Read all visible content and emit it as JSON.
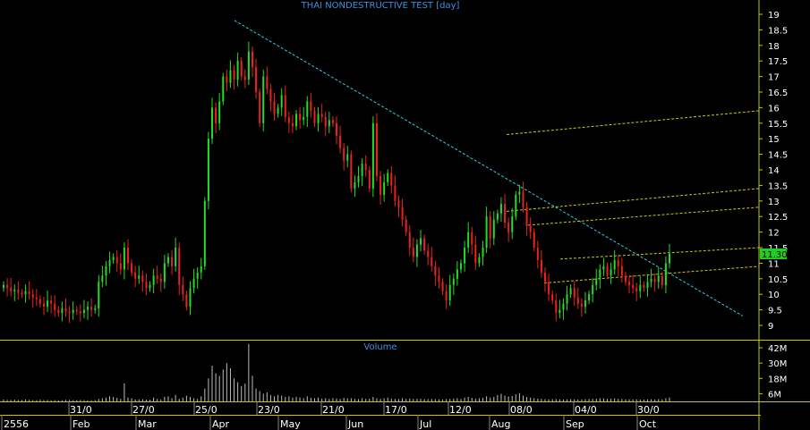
{
  "chart_data": {
    "type": "candlestick",
    "title": "THAI NONDESTRUCTIVE TEST [day]",
    "volume_title": "Volume",
    "price_axis": {
      "min": 9,
      "max": 19,
      "ticks": [
        19,
        18.5,
        18,
        17.5,
        17,
        16.5,
        16,
        15.5,
        15,
        14.5,
        14,
        13.5,
        13,
        12.5,
        12,
        11.5,
        11,
        10.5,
        10,
        9.5,
        9
      ]
    },
    "volume_axis": {
      "ticks": [
        "42M",
        "30M",
        "18M",
        "6M"
      ],
      "max_m": 48
    },
    "last_price": "11.30",
    "date_ticks": [
      "31/0",
      "27/0",
      "25/0",
      "23/0",
      "21/0",
      "17/0",
      "12/0",
      "08/0",
      "04/0",
      "30/0"
    ],
    "month_labels": [
      "2556",
      "Feb",
      "Mar",
      "Apr",
      "May",
      "Jun",
      "Jul",
      "Aug",
      "Sep",
      "Oct"
    ],
    "colors": {
      "up": "#22dd22",
      "down": "#ee2020",
      "trend": "#2fd0e0",
      "channel": "#c8c820",
      "axis": "#c8c800",
      "last_label": "#22cc22",
      "title": "#3d8fe0"
    },
    "closes": [
      10.3,
      10.2,
      10.1,
      10.15,
      10.05,
      10.0,
      10.1,
      10.0,
      9.9,
      9.85,
      9.7,
      9.6,
      9.8,
      9.7,
      9.5,
      9.4,
      9.55,
      9.45,
      9.4,
      9.5,
      9.45,
      9.4,
      9.5,
      9.6,
      9.5,
      9.55,
      10.4,
      10.6,
      10.9,
      11.1,
      11.2,
      11.0,
      10.8,
      11.5,
      11.0,
      10.7,
      10.5,
      10.6,
      10.4,
      10.2,
      10.3,
      10.6,
      10.5,
      10.4,
      11.0,
      11.2,
      10.9,
      11.5,
      10.3,
      10.0,
      9.6,
      10.2,
      10.5,
      10.7,
      10.9,
      13.0,
      15.0,
      16.0,
      15.5,
      16.2,
      17.0,
      16.8,
      17.2,
      16.9,
      17.5,
      17.0,
      16.9,
      17.8,
      17.3,
      16.5,
      15.5,
      17.0,
      16.6,
      16.2,
      15.8,
      16.0,
      16.4,
      15.7,
      15.5,
      15.4,
      15.8,
      15.6,
      15.7,
      16.2,
      15.9,
      15.5,
      15.8,
      15.7,
      15.4,
      15.6,
      15.5,
      15.1,
      14.7,
      14.3,
      14.5,
      13.4,
      13.6,
      13.8,
      14.2,
      14.0,
      13.4,
      15.5,
      13.8,
      13.2,
      13.6,
      13.9,
      13.5,
      13.0,
      12.8,
      12.4,
      12.0,
      11.5,
      11.2,
      11.6,
      11.8,
      11.4,
      11.2,
      10.9,
      10.6,
      10.4,
      10.1,
      9.8,
      10.3,
      10.5,
      10.8,
      11.0,
      11.5,
      12.0,
      11.6,
      11.0,
      11.2,
      11.5,
      12.5,
      11.8,
      12.4,
      12.6,
      12.9,
      12.3,
      12.0,
      12.5,
      13.2,
      13.3,
      12.8,
      12.2,
      12.0,
      11.5,
      11.1,
      10.7,
      10.4,
      10.0,
      9.8,
      9.4,
      9.5,
      9.7,
      10.0,
      10.2,
      9.9,
      9.7,
      9.6,
      9.8,
      10.0,
      10.3,
      10.5,
      10.8,
      10.9,
      10.6,
      10.8,
      11.1,
      10.9,
      10.6,
      10.4,
      10.3,
      10.2,
      10.1,
      10.3,
      10.2,
      10.4,
      10.5,
      10.4,
      10.6,
      10.3,
      11.0,
      11.3
    ],
    "volume_m": [
      1.5,
      1.2,
      1.1,
      1.4,
      1.1,
      1.0,
      1.6,
      1.2,
      1.0,
      0.9,
      1.3,
      1.0,
      1.1,
      0.9,
      1.0,
      0.8,
      0.9,
      1.2,
      1.1,
      1.0,
      0.9,
      1.1,
      1.0,
      0.8,
      0.9,
      1.0,
      2.0,
      2.5,
      3.0,
      4.0,
      3.5,
      2.8,
      2.0,
      14.0,
      3.0,
      2.5,
      1.5,
      1.6,
      1.8,
      1.4,
      1.2,
      3.0,
      2.0,
      1.5,
      3.5,
      4.0,
      2.5,
      5.0,
      2.0,
      3.0,
      4.5,
      3.5,
      2.5,
      2.0,
      4.0,
      10.0,
      18.0,
      28.0,
      22.0,
      20.0,
      25.0,
      30.0,
      26.0,
      18.0,
      15.0,
      12.0,
      14.0,
      45.0,
      20.0,
      10.0,
      8.0,
      6.0,
      7.0,
      5.0,
      4.0,
      5.0,
      4.5,
      3.5,
      4.0,
      3.0,
      3.5,
      3.0,
      2.5,
      4.0,
      2.8,
      2.5,
      3.0,
      2.2,
      2.5,
      2.0,
      2.5,
      2.3,
      2.0,
      2.8,
      2.4,
      2.5,
      2.0,
      1.8,
      2.5,
      2.0,
      2.2,
      3.5,
      2.5,
      2.0,
      2.5,
      3.0,
      2.2,
      2.0,
      1.8,
      2.5,
      2.0,
      2.3,
      1.9,
      2.0,
      2.1,
      1.8,
      1.7,
      1.9,
      1.8,
      1.6,
      1.5,
      1.8,
      2.0,
      2.2,
      2.5,
      2.0,
      3.0,
      3.5,
      2.8,
      2.2,
      2.5,
      2.7,
      4.0,
      3.0,
      3.5,
      5.0,
      6.0,
      4.5,
      3.8,
      4.2,
      5.5,
      6.5,
      4.5,
      3.5,
      3.0,
      2.5,
      2.2,
      2.0,
      1.8,
      1.6,
      1.8,
      1.9,
      1.7,
      1.5,
      1.6,
      1.8,
      1.7,
      1.5,
      1.6,
      1.8,
      1.9,
      2.0,
      2.2,
      2.5,
      2.3,
      2.0,
      2.1,
      2.4,
      2.0,
      1.8,
      1.7,
      1.6,
      1.5,
      1.6,
      1.5,
      1.4,
      1.6,
      1.7,
      1.5,
      1.8,
      1.6,
      2.5,
      3.0
    ],
    "trendlines": [
      {
        "kind": "trend",
        "from": [
          0.0,
          18.8
        ],
        "to": [
          1.0,
          9.3
        ]
      },
      {
        "kind": "channel",
        "from": [
          0.0,
          13.6
        ],
        "to": [
          1.0,
          15.9
        ]
      },
      {
        "kind": "channel",
        "from": [
          0.0,
          11.2
        ],
        "to": [
          1.0,
          13.4
        ]
      },
      {
        "kind": "channel",
        "from": [
          0.0,
          10.9
        ],
        "to": [
          1.0,
          12.8
        ]
      },
      {
        "kind": "channel",
        "from": [
          0.0,
          10.1
        ],
        "to": [
          1.0,
          11.5
        ]
      },
      {
        "kind": "channel",
        "from": [
          0.0,
          9.0
        ],
        "to": [
          1.0,
          10.9
        ]
      }
    ]
  }
}
